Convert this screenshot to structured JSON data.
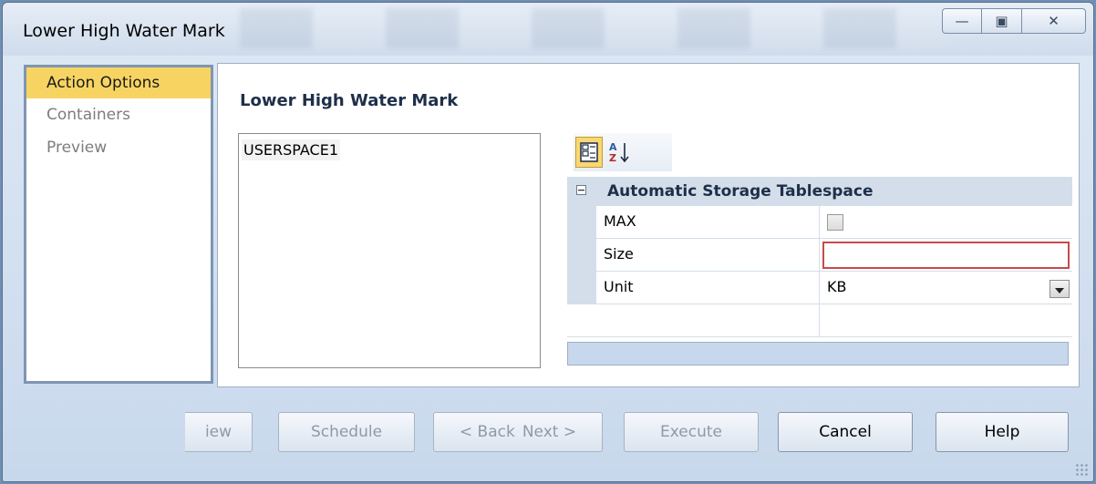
{
  "window": {
    "title": "Lower High Water Mark",
    "controls": {
      "minimize": "—",
      "maximize": "▣",
      "close": "✕"
    }
  },
  "nav": {
    "items": [
      {
        "label": "Action Options",
        "active": true
      },
      {
        "label": "Containers",
        "active": false
      },
      {
        "label": "Preview",
        "active": false
      }
    ]
  },
  "main": {
    "title": "Lower High Water Mark",
    "tablespaces": [
      "USERSPACE1"
    ]
  },
  "property_grid": {
    "toolbar": {
      "categorized_icon": "categorized-icon",
      "alphabetical_icon": "sort-az-icon"
    },
    "category": "Automatic Storage Tablespace",
    "rows": [
      {
        "name": "MAX",
        "type": "checkbox",
        "checked": false
      },
      {
        "name": "Size",
        "type": "text",
        "value": ""
      },
      {
        "name": "Unit",
        "type": "dropdown",
        "value": "KB"
      }
    ]
  },
  "buttons": {
    "preview": {
      "label": "iew",
      "enabled": false
    },
    "schedule": {
      "label": "Schedule",
      "enabled": false
    },
    "back": {
      "label": "< Back",
      "enabled": false
    },
    "next": {
      "label": "Next >",
      "enabled": false
    },
    "execute": {
      "label": "Execute",
      "enabled": false
    },
    "cancel": {
      "label": "Cancel",
      "enabled": true
    },
    "help": {
      "label": "Help",
      "enabled": true
    }
  },
  "colors": {
    "nav_active": "#f7d462",
    "category_band": "#d3deea",
    "size_invalid_border": "#c84a4a"
  }
}
